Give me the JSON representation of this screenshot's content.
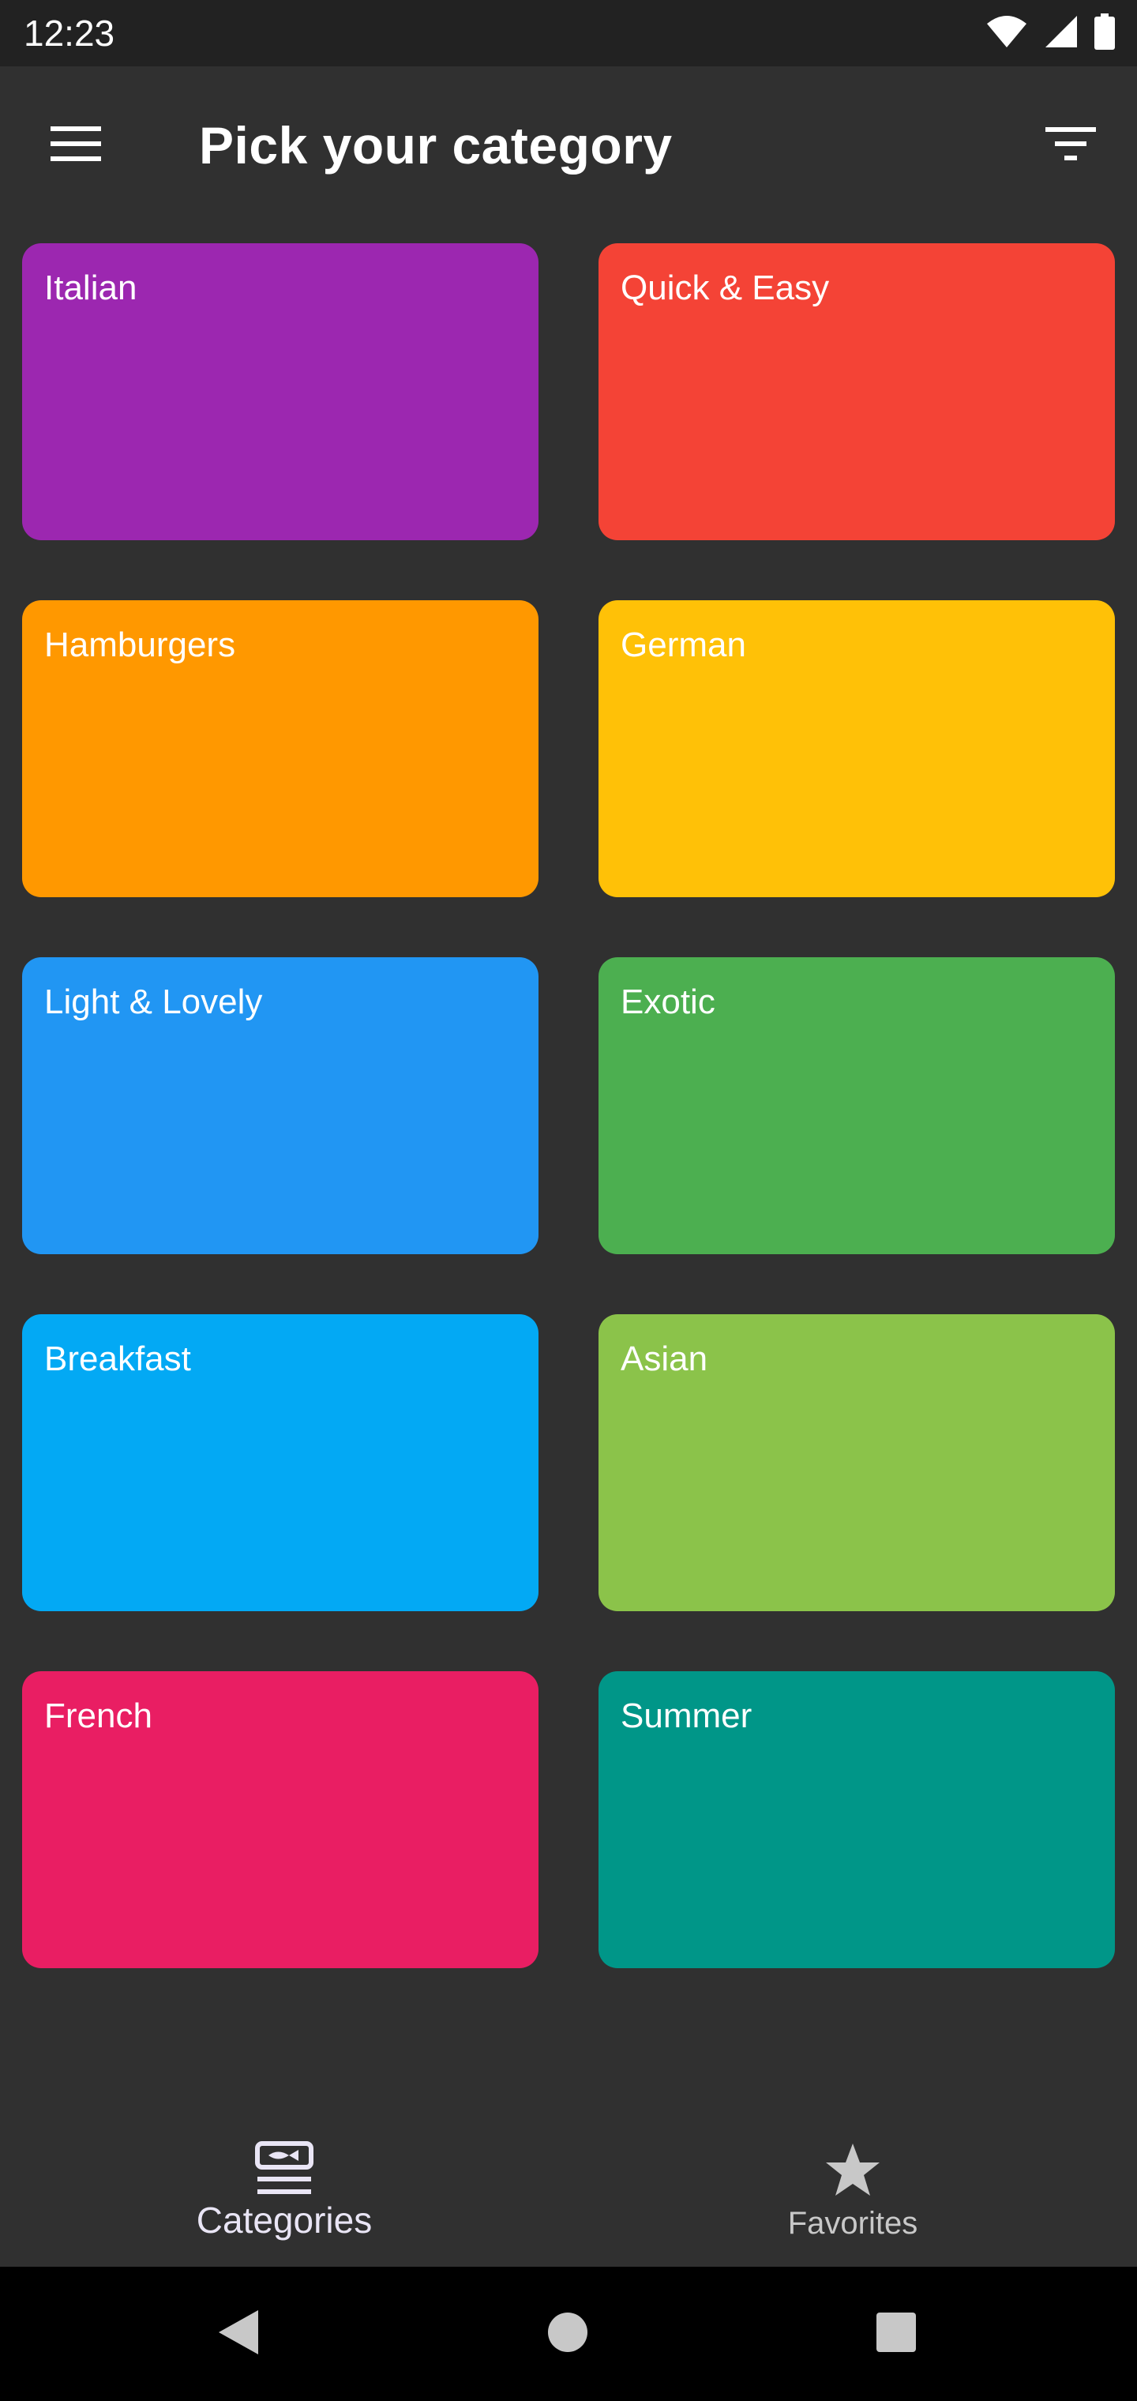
{
  "status_bar": {
    "time": "12:23",
    "icons": [
      "wifi-icon",
      "cell-signal-icon",
      "battery-icon"
    ]
  },
  "app_bar": {
    "title": "Pick your category",
    "menu_icon": "hamburger-menu-icon",
    "filter_icon": "filter-icon"
  },
  "categories": [
    {
      "label": "Italian",
      "color": "#9C27B0"
    },
    {
      "label": "Quick & Easy",
      "color": "#F44336"
    },
    {
      "label": "Hamburgers",
      "color": "#FF9800"
    },
    {
      "label": "German",
      "color": "#FFC107"
    },
    {
      "label": "Light & Lovely",
      "color": "#2196F3"
    },
    {
      "label": "Exotic",
      "color": "#4CAF50"
    },
    {
      "label": "Breakfast",
      "color": "#03A9F4"
    },
    {
      "label": "Asian",
      "color": "#8BC34A"
    },
    {
      "label": "French",
      "color": "#E91E63"
    },
    {
      "label": "Summer",
      "color": "#009688"
    }
  ],
  "bottom_nav": {
    "items": [
      {
        "label": "Categories",
        "icon": "category-icon",
        "selected": true
      },
      {
        "label": "Favorites",
        "icon": "star-icon",
        "selected": false
      }
    ]
  },
  "system_nav": {
    "icons": [
      "back-icon",
      "home-icon",
      "recents-icon"
    ]
  }
}
